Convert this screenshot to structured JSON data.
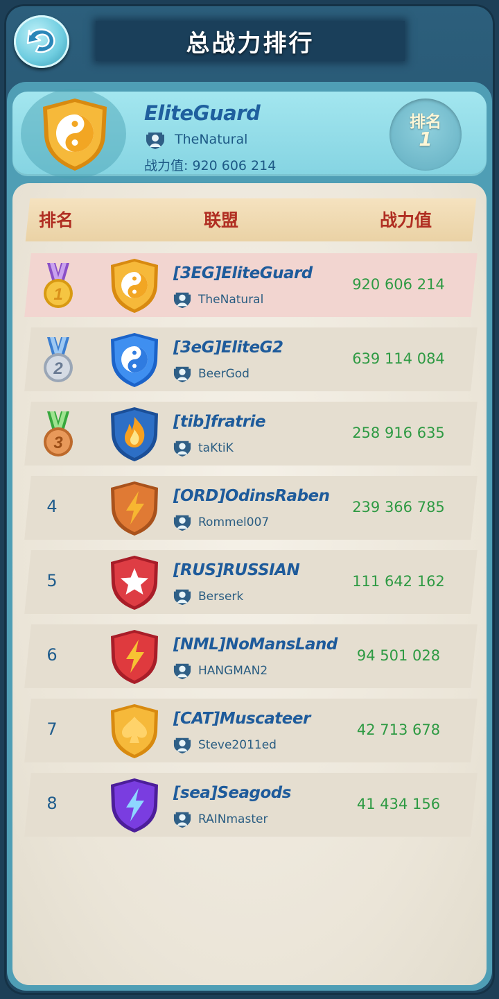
{
  "title": "总战力排行",
  "back_icon": "back-arrow-icon",
  "current_alliance": {
    "name": "EliteGuard",
    "leader": "TheNatural",
    "power_label": "战力值: 920 606 214",
    "rank_label": "排名",
    "rank_value": "1",
    "emblem": "yin-yang-gold-shield-icon"
  },
  "columns": {
    "rank": "排名",
    "alliance": "联盟",
    "power": "战力值"
  },
  "rows": [
    {
      "rank": "1",
      "medal": "gold-medal-icon",
      "name": "[3EG]EliteGuard",
      "leader": "TheNatural",
      "power": "920 606 214",
      "emblem": "yin-yang-gold-shield-icon"
    },
    {
      "rank": "2",
      "medal": "silver-medal-icon",
      "name": "[3eG]EliteG2",
      "leader": "BeerGod",
      "power": "639 114 084",
      "emblem": "yin-yang-blue-shield-icon"
    },
    {
      "rank": "3",
      "medal": "bronze-medal-icon",
      "name": "[tib]fratrie",
      "leader": "taKtiK",
      "power": "258 916 635",
      "emblem": "flame-blue-shield-icon"
    },
    {
      "rank": "4",
      "name": "[ORD]OdinsRaben",
      "leader": "Rommel007",
      "power": "239 366 785",
      "emblem": "lightning-orange-shield-icon"
    },
    {
      "rank": "5",
      "name": "[RUS]RUSSIAN",
      "leader": "Berserk",
      "power": "111 642 162",
      "emblem": "star-red-shield-icon"
    },
    {
      "rank": "6",
      "name": "[NML]NoMansLand",
      "leader": "HANGMAN2",
      "power": "94 501 028",
      "emblem": "lightning-red-shield-icon"
    },
    {
      "rank": "7",
      "name": "[CAT]Muscateer",
      "leader": "Steve2011ed",
      "power": "42 713 678",
      "emblem": "spade-gold-shield-icon"
    },
    {
      "rank": "8",
      "name": "[sea]Seagods",
      "leader": "RAINmaster",
      "power": "41 434 156",
      "emblem": "lightning-purple-shield-icon"
    }
  ],
  "colors": {
    "alliance_name": "#1e5b9b",
    "power": "#2e9a43",
    "header_text": "#b02e22",
    "highlight_row": "#f2d5d0"
  }
}
